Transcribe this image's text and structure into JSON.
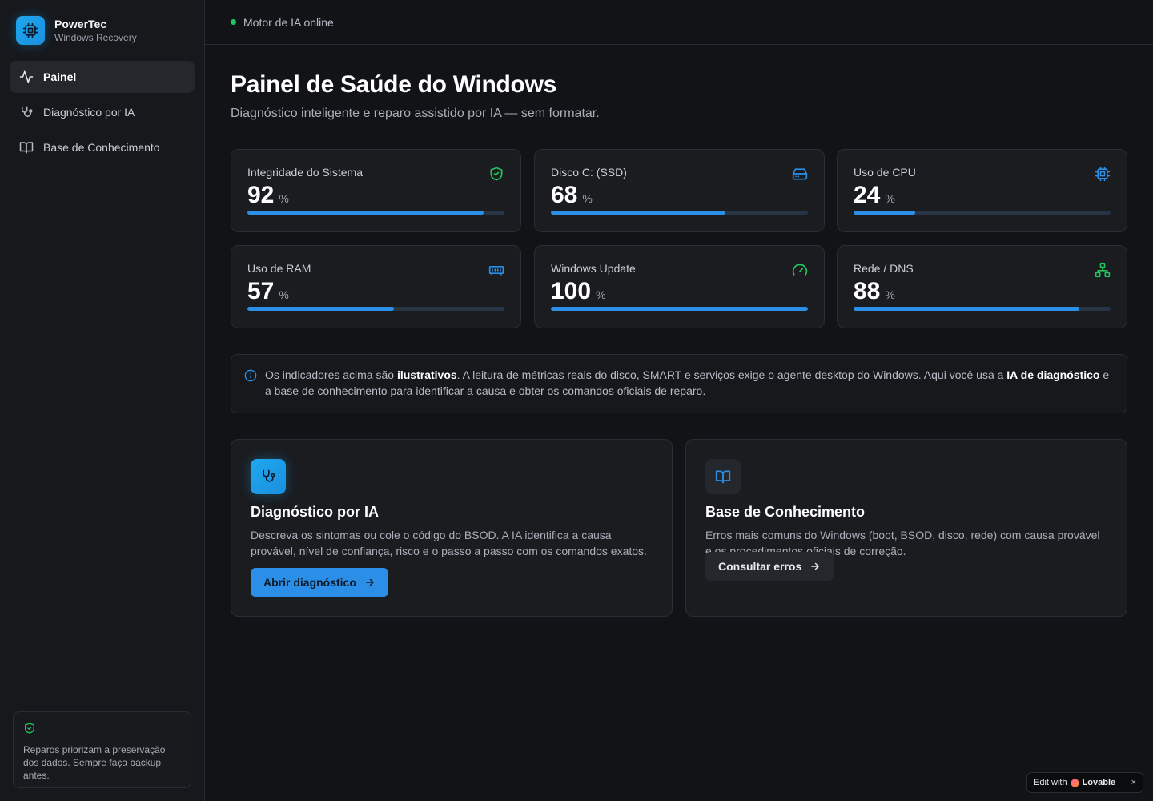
{
  "brand": {
    "name": "PowerTec",
    "subtitle": "Windows Recovery"
  },
  "sidebar": {
    "items": [
      {
        "label": "Painel",
        "icon": "activity-icon",
        "active": true
      },
      {
        "label": "Diagnóstico por IA",
        "icon": "stethoscope-icon",
        "active": false
      },
      {
        "label": "Base de Conhecimento",
        "icon": "book-open-icon",
        "active": false
      }
    ],
    "note": "Reparos priorizam a preservação dos dados. Sempre faça backup antes."
  },
  "topbar": {
    "status": "Motor de IA online",
    "status_color": "#22c55e"
  },
  "page": {
    "title": "Painel de Saúde do Windows",
    "subtitle": "Diagnóstico inteligente e reparo assistido por IA — sem formatar."
  },
  "metrics": [
    {
      "label": "Integridade do Sistema",
      "value": "92",
      "unit": "%",
      "percent": 92,
      "icon": "shield-check-icon"
    },
    {
      "label": "Disco C: (SSD)",
      "value": "68",
      "unit": "%",
      "percent": 68,
      "icon": "hard-drive-icon"
    },
    {
      "label": "Uso de CPU",
      "value": "24",
      "unit": "%",
      "percent": 24,
      "icon": "cpu-icon"
    },
    {
      "label": "Uso de RAM",
      "value": "57",
      "unit": "%",
      "percent": 57,
      "icon": "memory-stick-icon"
    },
    {
      "label": "Windows Update",
      "value": "100",
      "unit": "%",
      "percent": 100,
      "icon": "gauge-icon"
    },
    {
      "label": "Rede / DNS",
      "value": "88",
      "unit": "%",
      "percent": 88,
      "icon": "network-icon"
    }
  ],
  "info": {
    "t1": "Os indicadores acima são ",
    "b1": "ilustrativos",
    "t2": ". A leitura de métricas reais do disco, SMART e serviços exige o agente desktop do Windows. Aqui você usa a ",
    "b2": "IA de diagnóstico",
    "t3": " e a base de conhecimento para identificar a causa e obter os comandos oficiais de reparo."
  },
  "cards": {
    "diagnostic": {
      "title": "Diagnóstico por IA",
      "description": "Descreva os sintomas ou cole o código do BSOD. A IA identifica a causa provável, nível de confiança, risco e o passo a passo com os comandos exatos.",
      "button": "Abrir diagnóstico"
    },
    "knowledge": {
      "title": "Base de Conhecimento",
      "description": "Erros mais comuns do Windows (boot, BSOD, disco, rede) com causa provável e os procedimentos oficiais de correção.",
      "button": "Consultar erros"
    }
  },
  "badge": {
    "prefix": "Edit with",
    "brand": "Lovable",
    "close": "×"
  },
  "colors": {
    "accent": "#2b8fe8",
    "success": "#22c55e",
    "background": "#111316"
  }
}
